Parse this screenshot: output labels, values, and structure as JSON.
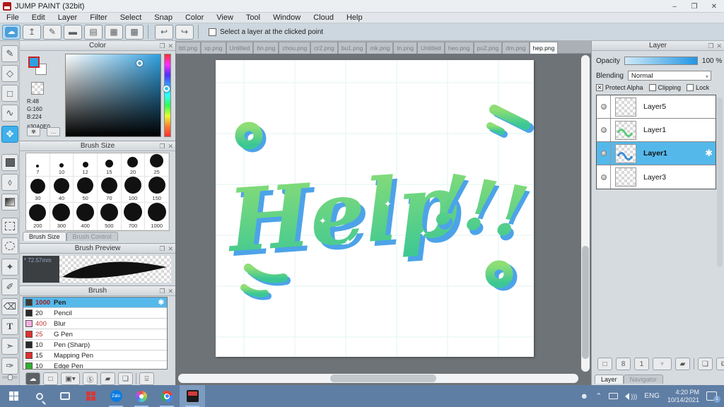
{
  "window": {
    "title": "JUMP PAINT (32bit)"
  },
  "menu": {
    "items": [
      "File",
      "Edit",
      "Layer",
      "Filter",
      "Select",
      "Snap",
      "Color",
      "View",
      "Tool",
      "Window",
      "Cloud",
      "Help"
    ]
  },
  "toolbar": {
    "select_layer_label": "Select a layer at the clicked point"
  },
  "color_panel": {
    "title": "Color",
    "r_label": "R:48",
    "g_label": "G:160",
    "b_label": "B:224",
    "hex_label": "#30A0E0",
    "foreground_color": "#30A0E0"
  },
  "brush_size_panel": {
    "title": "Brush Size",
    "sizes": [
      "7",
      "10",
      "12",
      "15",
      "20",
      "25",
      "30",
      "40",
      "50",
      "70",
      "100",
      "150",
      "200",
      "300",
      "400",
      "500",
      "700",
      "1000"
    ],
    "tab_active": "Brush Size",
    "tab_inactive": "Brush Control"
  },
  "brush_preview_panel": {
    "title": "Brush Preview",
    "size_label": "* 72.57mm"
  },
  "brush_panel": {
    "title": "Brush",
    "items": [
      {
        "size": "1000",
        "name": "Pen",
        "swatch": "#3a3a3a",
        "selected": true
      },
      {
        "size": "20",
        "name": "Pencil",
        "swatch": "#2a2a2a"
      },
      {
        "size": "400",
        "name": "Blur",
        "swatch": "#f5b0e0"
      },
      {
        "size": "25",
        "name": "G Pen",
        "swatch": "#e03030"
      },
      {
        "size": "10",
        "name": "Pen (Sharp)",
        "swatch": "#2a2a2a"
      },
      {
        "size": "15",
        "name": "Mapping Pen",
        "swatch": "#e03030"
      },
      {
        "size": "10",
        "name": "Edge Pen",
        "swatch": "#30b030"
      }
    ]
  },
  "document_tabs": {
    "items": [
      "btt.png",
      "xp.png",
      "Untitled",
      "bn.png",
      "chou.png",
      "cr2.png",
      "bu1.png",
      "mk.png",
      "tn.png",
      "Untitled",
      "heo.png",
      "pu2.png",
      "dm.png",
      "hep.png"
    ],
    "active": "hep.png"
  },
  "canvas": {
    "word": "Help",
    "exclaim": "!!!"
  },
  "layer_panel": {
    "title": "Layer",
    "opacity_label": "Opacity",
    "opacity_value": "100 %",
    "blending_label": "Blending",
    "blending_value": "Normal",
    "protect_alpha_label": "Protect Alpha",
    "clipping_label": "Clipping",
    "lock_label": "Lock",
    "layers": [
      {
        "name": "Layer5"
      },
      {
        "name": "Layer1"
      },
      {
        "name": "Layer1",
        "selected": true
      },
      {
        "name": "Layer3"
      }
    ],
    "tab_active": "Layer",
    "tab_inactive": "Navigator"
  },
  "taskbar": {
    "zalo": "Zalo",
    "lang": "ENG",
    "time": "4:20 PM",
    "date": "10/14/2021",
    "badge": "1"
  },
  "colors": {
    "accent_blue": "#55b8ea",
    "taskbar_blue": "#5f7ea4",
    "art_green_light": "#8ede74",
    "art_green_dark": "#3bc795",
    "art_shadow_blue": "#4da3e8"
  }
}
